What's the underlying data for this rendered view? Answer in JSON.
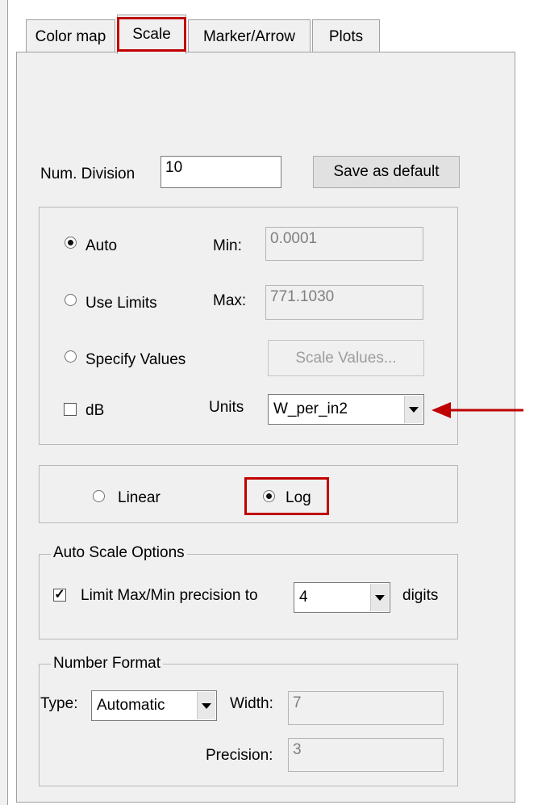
{
  "tabs": [
    {
      "label": "Color map",
      "active": false
    },
    {
      "label": "Scale",
      "active": true
    },
    {
      "label": "Marker/Arrow",
      "active": false
    },
    {
      "label": "Plots",
      "active": false
    }
  ],
  "num_division": {
    "label": "Num. Division",
    "value": "10"
  },
  "save_default_label": "Save as default",
  "limits": {
    "auto_label": "Auto",
    "use_limits_label": "Use Limits",
    "specify_values_label": "Specify Values",
    "selected": "Auto",
    "min_label": "Min:",
    "min_value": "0.0001",
    "max_label": "Max:",
    "max_value": "771.1030",
    "scale_values_label": "Scale Values...",
    "db_label": "dB",
    "db_checked": false,
    "units_label": "Units",
    "units_value": "W_per_in2"
  },
  "scale_type": {
    "linear_label": "Linear",
    "log_label": "Log",
    "selected": "Log"
  },
  "auto_scale": {
    "title": "Auto Scale Options",
    "limit_label": "Limit Max/Min precision to",
    "limit_checked": true,
    "digits_value": "4",
    "digits_label": "digits"
  },
  "number_format": {
    "title": "Number Format",
    "type_label": "Type:",
    "type_value": "Automatic",
    "width_label": "Width:",
    "width_value": "7",
    "precision_label": "Precision:",
    "precision_value": "3"
  },
  "colors": {
    "highlight": "#c00000",
    "panel": "#f0f0f0"
  }
}
